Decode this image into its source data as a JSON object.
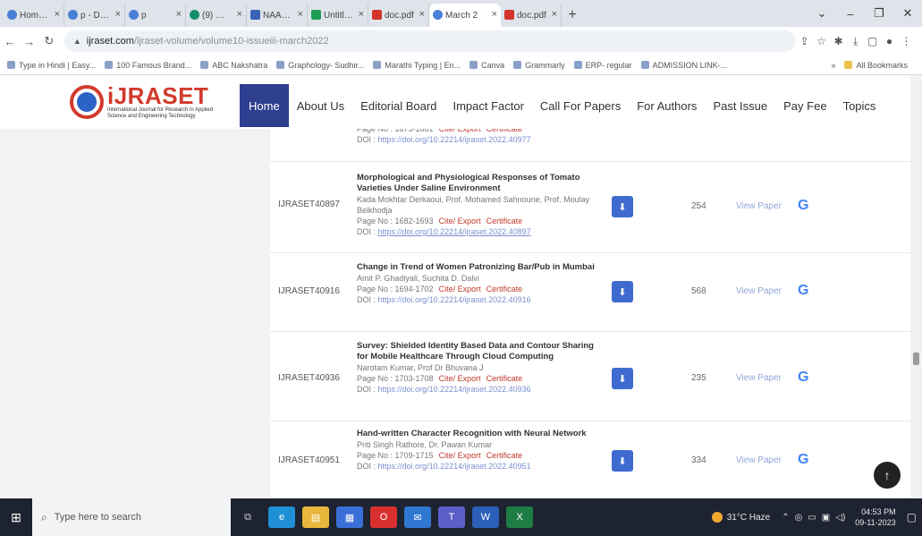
{
  "browser": {
    "tabs": [
      {
        "label": "Home - I",
        "fav": "blue"
      },
      {
        "label": "p - Docu",
        "fav": "blue"
      },
      {
        "label": "p",
        "fav": "blue"
      },
      {
        "label": "(9) Wha",
        "fav": "green"
      },
      {
        "label": "NAAC-R",
        "fav": "blue"
      },
      {
        "label": "Untitled",
        "fav": "green"
      },
      {
        "label": "doc.pdf",
        "fav": "red"
      },
      {
        "label": "March 2",
        "fav": "teal",
        "active": true
      },
      {
        "label": "doc.pdf",
        "fav": "red"
      }
    ],
    "new_tab": "+",
    "url_host": "ijraset.com",
    "url_path": "/ijraset-volume/volume10-issueiii-march2022",
    "bookmarks": [
      "Type in Hindi | Easy...",
      "100 Famous Brand...",
      "ABC Nakshatra",
      "Graphology- Sudhir...",
      "Marathi Typing | En...",
      "Canva",
      "Grammarly",
      "ERP- regular",
      "ADMISSION LINK-..."
    ],
    "bookmarks_more": "»",
    "all_bookmarks": "All Bookmarks"
  },
  "site": {
    "brand": "iJRASET",
    "brand_sub": "International Journal for Research in Applied Science and Engineering Technology",
    "nav": [
      "Home",
      "About Us",
      "Editorial Board",
      "Impact Factor",
      "Call For Papers",
      "For Authors",
      "Past Issue",
      "Pay Fee",
      "Topics"
    ]
  },
  "papers": [
    {
      "id": "",
      "title": "",
      "authors": "",
      "pages": "Page No : 1675-1681",
      "cite": "Cite/ Export",
      "cert": "Certificate",
      "doi_label": "DOI :",
      "doi": "https://doi.org/10.22214/ijraset.2022.40977",
      "views": "",
      "view_paper": ""
    },
    {
      "id": "IJRASET40897",
      "title": "Morphological and Physiological Responses of Tomato Varieties Under Saline Environment",
      "authors": "Kada Mokhtar Derkaoui, Prof. Mohamed Sahnoune, Prof. Moulay Belkhodja",
      "pages": "Page No : 1682-1693",
      "cite": "Cite/ Export",
      "cert": "Certificate",
      "doi_label": "DOI :",
      "doi": "https://doi.org/10.22214/ijraset.2022.40897",
      "views": "254",
      "view_paper": "View Paper"
    },
    {
      "id": "IJRASET40916",
      "title": "Change in Trend of Women Patronizing Bar/Pub in Mumbai",
      "authors": "Amit P. Ghadiyali, Suchita D. Dalvi",
      "pages": "Page No : 1694-1702",
      "cite": "Cite/ Export",
      "cert": "Certificate",
      "doi_label": "DOI :",
      "doi": "https://doi.org/10.22214/ijraset.2022.40916",
      "views": "568",
      "view_paper": "View Paper"
    },
    {
      "id": "IJRASET40936",
      "title": "Survey: Shielded Identity Based Data and Contour Sharing for Mobile Healthcare Through Cloud Computing",
      "authors": "Narotam Kumar, Prof Dr Bhuvana J",
      "pages": "Page No : 1703-1708",
      "cite": "Cite/ Export",
      "cert": "Certificate",
      "doi_label": "DOI :",
      "doi": "https://doi.org/10.22214/ijraset.2022.40936",
      "views": "235",
      "view_paper": "View Paper"
    },
    {
      "id": "IJRASET40951",
      "title": "Hand-written Character Recognition with Neural Network",
      "authors": "Priti Singh Rathore, Dr. Pawan Kumar",
      "pages": "Page No : 1709-1715",
      "cite": "Cite/ Export",
      "cert": "Certificate",
      "doi_label": "DOI :",
      "doi": "https://doi.org/10.22214/ijraset.2022.40951",
      "views": "334",
      "view_paper": "View Paper"
    }
  ],
  "taskbar": {
    "search_placeholder": "Type here to search",
    "weather": "31°C Haze",
    "time": "04:53 PM",
    "date": "09-11-2023"
  }
}
